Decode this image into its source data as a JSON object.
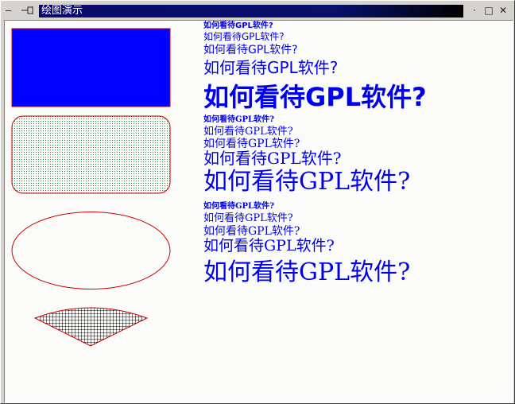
{
  "window": {
    "title": "绘图演示",
    "menu_glyph": "—",
    "minimize_glyph": "·",
    "maximize_glyph": "□",
    "close_glyph": "✕"
  },
  "colors": {
    "text_blue": "#0000ee",
    "rect_fill": "#0000ff",
    "shape_outline": "#cc0000",
    "pattern_green": "#1e8c3a",
    "grid_black": "#000000",
    "canvas_bg": "#fbfcfa"
  },
  "shapes": {
    "rectangle_fill": "solid blue",
    "rounded_rect_fill": "green dots",
    "ellipse_fill": "none",
    "fan_fill": "black grid"
  },
  "text_samples": {
    "sans_bold": "如何看待GPL软件?",
    "sans_regular": "如何看待GPL软件?",
    "sans_2": "如何看待GPL软件?",
    "sans_3": "如何看待GPL软件?",
    "sans_bold_large": "如何看待GPL软件?",
    "serif_bold_small": "如何看待GPL软件?",
    "serif_1": "如何看待GPL软件?",
    "serif_2": "如何看待GPL软件?",
    "serif_3": "如何看待GPL软件?",
    "serif_large": "如何看待GPL软件?",
    "mixed_bold_small": "如何看待GPL软件?",
    "mixed_1": "如何看待GPL软件?",
    "mixed_2": "如何看待GPL软件?",
    "mixed_3": "如何看待GPL软件?",
    "mixed_large": "如何看待GPL软件?"
  }
}
